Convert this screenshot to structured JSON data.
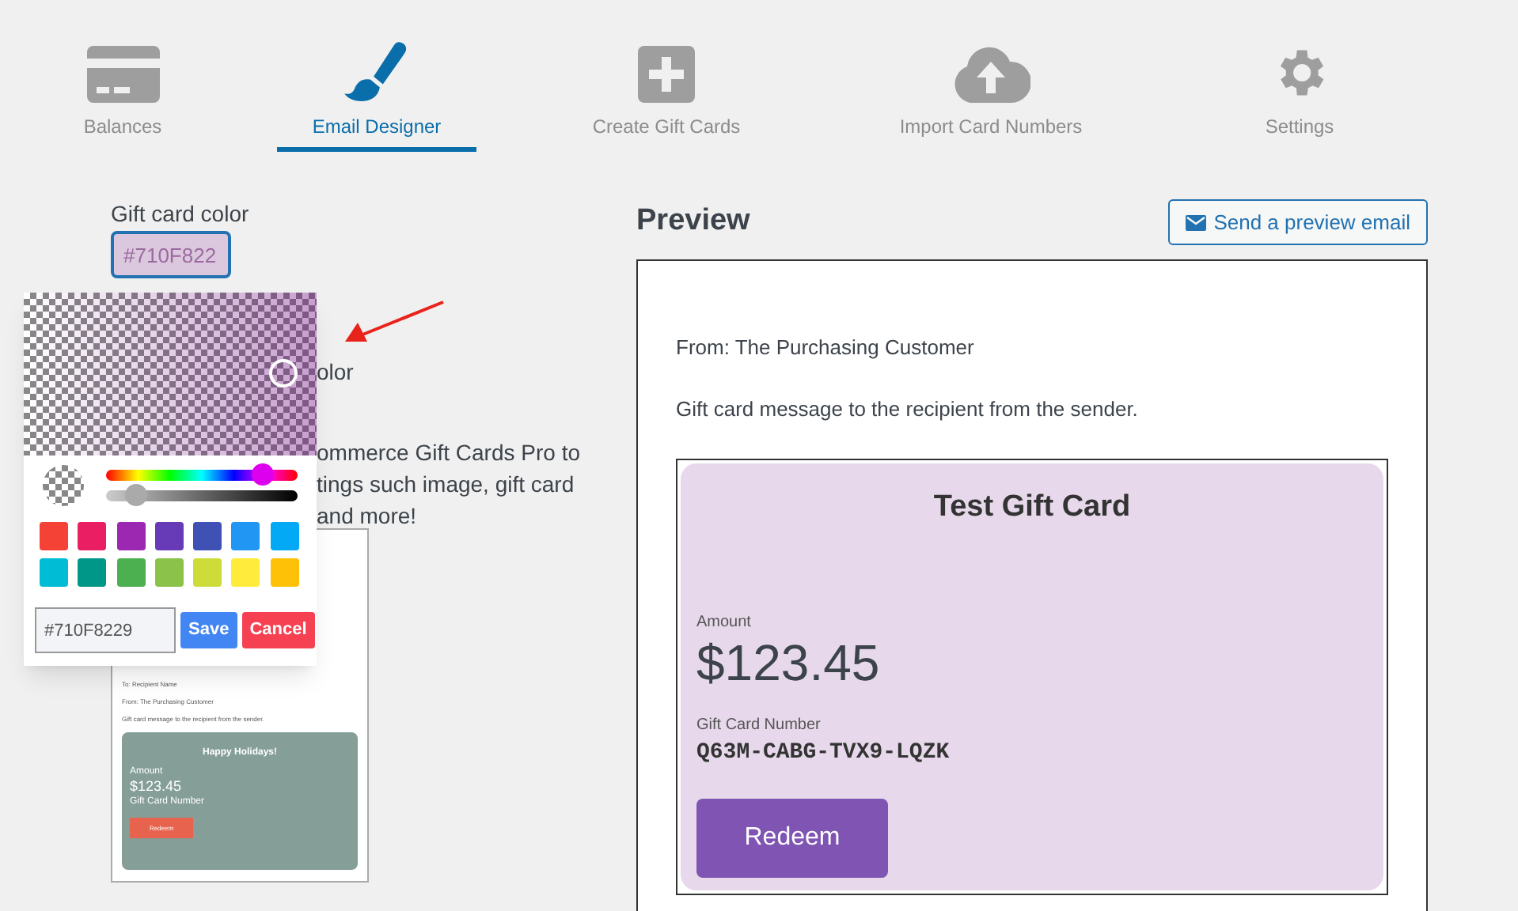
{
  "tabs": [
    {
      "label": "Balances",
      "kind": "card",
      "selected": false
    },
    {
      "label": "Email Designer",
      "kind": "brush",
      "selected": true
    },
    {
      "label": "Create Gift Cards",
      "kind": "plus",
      "selected": false
    },
    {
      "label": "Import Card Numbers",
      "kind": "cloud",
      "selected": false
    },
    {
      "label": "Settings",
      "kind": "gear",
      "selected": false
    }
  ],
  "settings": {
    "gift_card_color": {
      "label": "Gift card color",
      "value": "#710F822"
    },
    "hidden_label_tail": "olor",
    "description_lines": [
      "ommerce Gift Cards Pro to",
      "tings such image, gift card",
      "and more!"
    ],
    "thumbnail": {
      "to": "To: Recipient Name",
      "from": "From: The Purchasing Customer",
      "message": "Gift card message to the recipient from the sender.",
      "card_title": "Happy Holidays!",
      "amount_label": "Amount",
      "amount": "$123.45",
      "number_label": "Gift Card Number",
      "button": "Redeem"
    }
  },
  "color_picker": {
    "hue": {
      "level": 0.82
    },
    "alpha": {
      "level": 0.16
    },
    "swatches": [
      {
        "color": "#f44336"
      },
      {
        "color": "#e91e63"
      },
      {
        "color": "#9c27b0"
      },
      {
        "color": "#673ab7"
      },
      {
        "color": "#3f51b5"
      },
      {
        "color": "#2196f3"
      },
      {
        "color": "#03a9f4"
      },
      {
        "color": "#00bcd4"
      },
      {
        "color": "#009688"
      },
      {
        "color": "#4caf50"
      },
      {
        "color": "#8bc34a"
      },
      {
        "color": "#cddc39"
      },
      {
        "color": "#ffeb3b"
      },
      {
        "color": "#ffc107"
      }
    ],
    "value": "#710F8229",
    "save": "Save",
    "cancel": "Cancel"
  },
  "preview": {
    "title": "Preview",
    "send_button": "Send a preview email",
    "from": "From: The Purchasing Customer",
    "message": "Gift card message to the recipient from the sender.",
    "card": {
      "title": "Test Gift Card",
      "amount_label": "Amount",
      "amount": "$123.45",
      "number_label": "Gift Card Number",
      "number": "Q63M-CABG-TVX9-LQZK",
      "button": "Redeem"
    }
  }
}
